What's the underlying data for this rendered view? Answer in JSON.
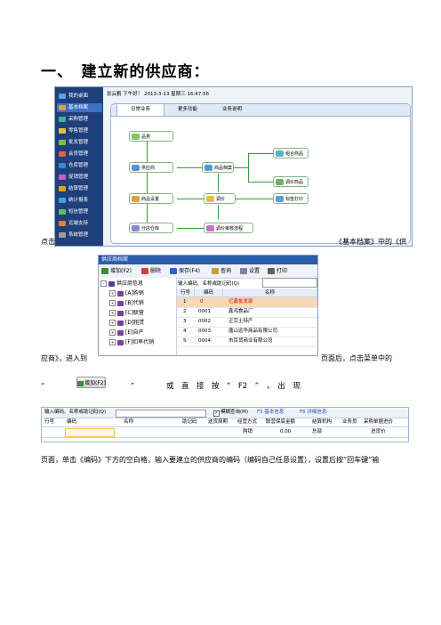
{
  "heading": "一、　建立新的供应商：",
  "para1": {
    "before": "点击",
    "after": "《基本档案》中的《供"
  },
  "para2": {
    "before": "应商》，进入到",
    "after": "页面后，点击菜单中的"
  },
  "para3": {
    "q1": "“",
    "q2": "”",
    "middle": "或　直　接　按　“　F2　”　，　出　现"
  },
  "para4": "页面，单击《编码》下方的空白格，输入要建立的供应商的编码（编码自己任意设置），设置后按“回车键”输",
  "shot1": {
    "sidebar": [
      {
        "label": "我的桌面",
        "color": "#5aa0e0"
      },
      {
        "label": "基本档案",
        "color": "#e0a030"
      },
      {
        "label": "采购管理",
        "color": "#40b0a0"
      },
      {
        "label": "零售管理",
        "color": "#e0c040"
      },
      {
        "label": "批发管理",
        "color": "#80c040"
      },
      {
        "label": "会员管理",
        "color": "#e06040"
      },
      {
        "label": "仓库管理",
        "color": "#4080e0"
      },
      {
        "label": "促销管理",
        "color": "#c060c0"
      },
      {
        "label": "结算管理",
        "color": "#e0a030"
      },
      {
        "label": "统计报表",
        "color": "#40a0e0"
      },
      {
        "label": "短信管理",
        "color": "#60c060"
      },
      {
        "label": "远端支持",
        "color": "#e08040"
      },
      {
        "label": "系统管理",
        "color": "#a0a0a0"
      }
    ],
    "status": "张云鹏 下午好！ 2013-3-13 星期三 16:47:56",
    "tabs": [
      "日常业务",
      "更多功能",
      "业务说明"
    ],
    "nodes": [
      "品类",
      "供应商",
      "商品档案",
      "组合商品",
      "商品设置",
      "调价",
      "调价商品",
      "标签打印",
      "分店仓库",
      "调价审核流程"
    ]
  },
  "shot2": {
    "title": "供应商档案",
    "toolbar": [
      "增加(F2)",
      "删除",
      "保存(F4)",
      "查询",
      "设置",
      "打印"
    ],
    "tree": [
      "供应商信息",
      "[A]购销",
      "[B]代销",
      "[C]联营",
      "[D]租赁",
      "[E]自产",
      "[F]扣率代销"
    ],
    "search_label": "输入编码、名称或助记码(Q)",
    "columns": [
      "行号",
      "编码",
      "名称"
    ],
    "rows": [
      {
        "no": "1",
        "code": "0",
        "name": "亿鑫批发部"
      },
      {
        "no": "2",
        "code": "0001",
        "name": "鑫鸿食品厂"
      },
      {
        "no": "3",
        "code": "0002",
        "name": "正宗土特产"
      },
      {
        "no": "4",
        "code": "0003",
        "name": "唐山远华商品有限公司"
      },
      {
        "no": "5",
        "code": "0004",
        "name": "市百货商业有限公司"
      }
    ]
  },
  "add_button": "增加(F2)",
  "shot3": {
    "search_label": "输入编码、名称或助记码(Q)",
    "fuzzy": "模糊查询(M)",
    "f5": "F5 基本信息",
    "f6": "F6 详细信息",
    "columns": [
      "行号",
      "编码",
      "名称",
      "助记码",
      "送货周期",
      "经营方式",
      "联营保底金额",
      "结算机构",
      "业务员",
      "采购单据进价"
    ],
    "row": {
      "mode": "购销",
      "amount": "0.00",
      "org": "总部",
      "price": "进货价"
    }
  }
}
